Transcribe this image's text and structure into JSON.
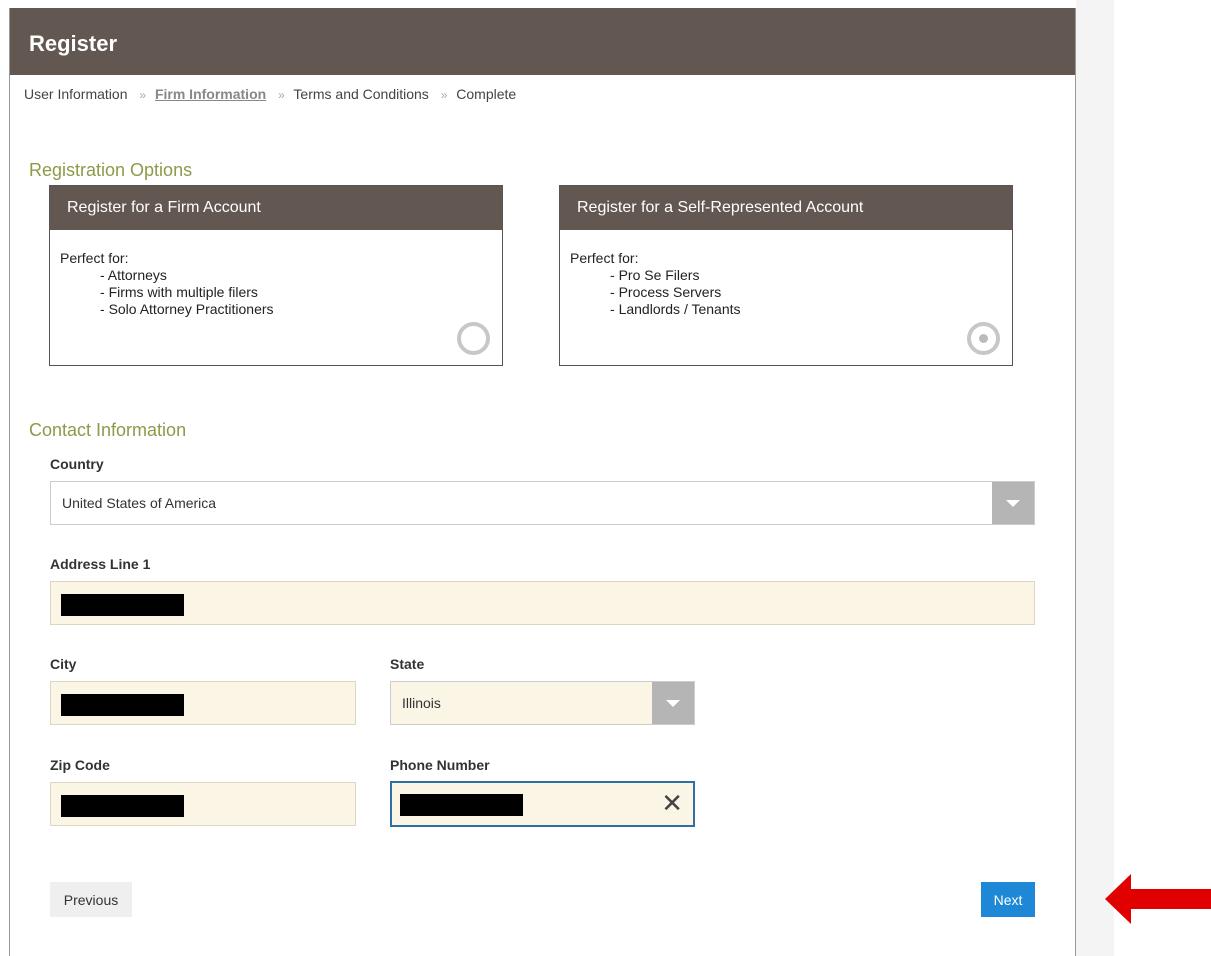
{
  "header": {
    "title": "Register"
  },
  "breadcrumb": [
    {
      "label": "User Information"
    },
    {
      "label": "Firm Information",
      "active": true
    },
    {
      "label": "Terms and Conditions"
    },
    {
      "label": "Complete"
    }
  ],
  "breadcrumb_separator": "»",
  "registration": {
    "title": "Registration Options",
    "options": [
      {
        "title": "Register for a Firm Account",
        "intro": "Perfect for:",
        "items": [
          "Attorneys",
          "Firms with multiple filers",
          "Solo Attorney Practitioners"
        ],
        "selected": false
      },
      {
        "title": "Register for a Self-Represented Account",
        "intro": "Perfect for:",
        "items": [
          "Pro Se Filers",
          "Process Servers",
          "Landlords / Tenants"
        ],
        "selected": true
      }
    ]
  },
  "contact": {
    "title": "Contact Information",
    "country": {
      "label": "Country",
      "value": "United States of America"
    },
    "address1": {
      "label": "Address Line 1"
    },
    "city": {
      "label": "City"
    },
    "state": {
      "label": "State",
      "value": "Illinois"
    },
    "zip": {
      "label": "Zip Code"
    },
    "phone": {
      "label": "Phone Number",
      "clear_icon": "close-icon"
    }
  },
  "nav": {
    "previous_label": "Previous",
    "next_label": "Next"
  },
  "colors": {
    "header_bg": "#635752",
    "section_title": "#8c9a4a",
    "field_fill": "#fbf5e6",
    "primary_button": "#1e88d6",
    "annotation_arrow": "#e00000"
  }
}
